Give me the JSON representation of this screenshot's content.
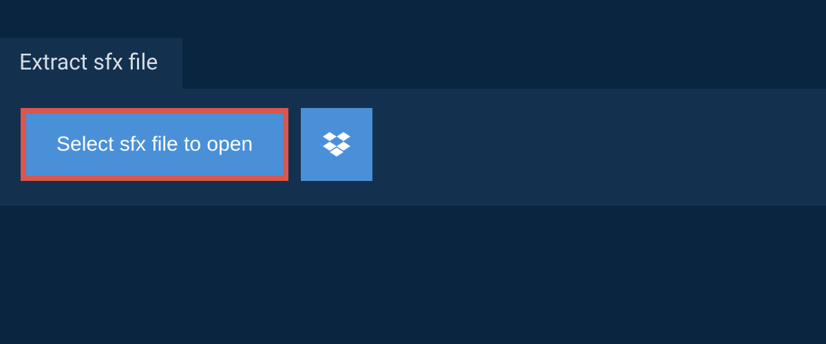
{
  "tab": {
    "label": "Extract sfx file"
  },
  "actions": {
    "select_file_label": "Select sfx file to open"
  }
}
